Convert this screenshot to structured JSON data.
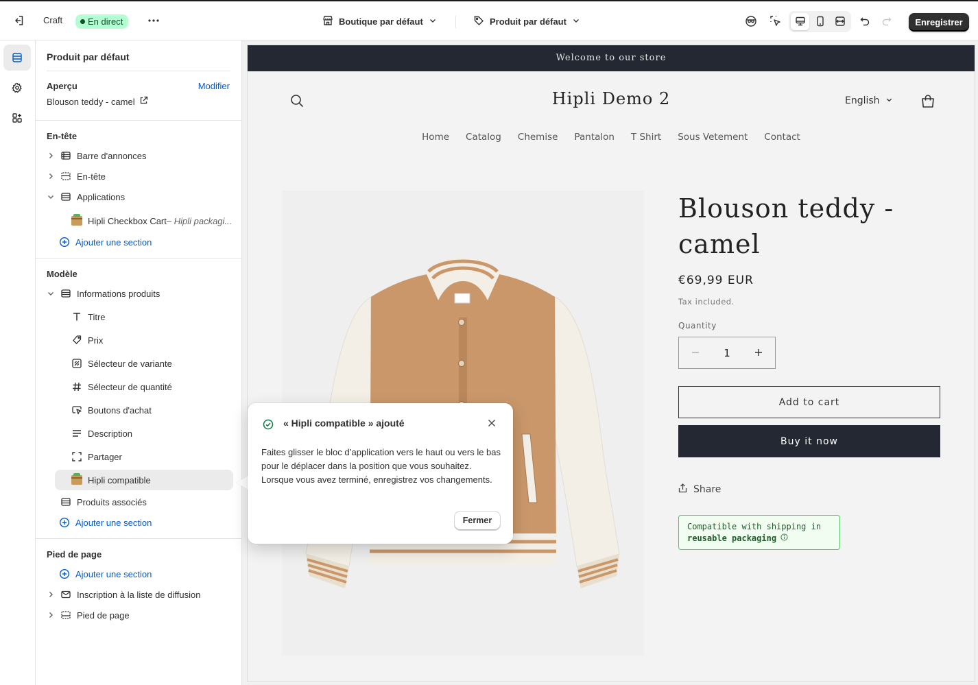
{
  "topbar": {
    "app_name": "Craft",
    "status": "En direct",
    "store_select": "Boutique par défaut",
    "product_select": "Produit par défaut",
    "save_label": "Enregistrer"
  },
  "sidebar": {
    "title": "Produit par défaut",
    "preview_heading": "Aperçu",
    "preview_edit": "Modifier",
    "preview_product": "Blouson teddy - camel",
    "header_group": {
      "title": "En-tête",
      "items": [
        "Barre d'annonces",
        "En-tête",
        "Applications"
      ],
      "app_block": "Hipli Checkbox Cart",
      "app_block_sub": " – Hipli packagi...",
      "add_section": "Ajouter une section"
    },
    "template_group": {
      "title": "Modèle",
      "section": "Informations produits",
      "blocks": [
        "Titre",
        "Prix",
        "Sélecteur de variante",
        "Sélecteur de quantité",
        "Boutons d'achat",
        "Description",
        "Partager",
        "Hipli compatible"
      ],
      "related": "Produits associés",
      "add_section": "Ajouter une section"
    },
    "footer_group": {
      "title": "Pied de page",
      "add_section": "Ajouter une section",
      "items": [
        "Inscription à la liste de diffusion",
        "Pied de page"
      ]
    }
  },
  "store": {
    "announcement": "Welcome to our store",
    "name": "Hipli Demo 2",
    "language": "English",
    "nav": [
      "Home",
      "Catalog",
      "Chemise",
      "Pantalon",
      "T Shirt",
      "Sous Vetement",
      "Contact"
    ],
    "product": {
      "title": "Blouson teddy - camel",
      "price": "€69,99 EUR",
      "tax": "Tax included.",
      "quantity_label": "Quantity",
      "quantity": "1",
      "add_to_cart": "Add to cart",
      "buy_now": "Buy it now",
      "share": "Share",
      "hipli_line1": "Compatible with shipping in",
      "hipli_line2": "reusable packaging"
    }
  },
  "popover": {
    "title": "« Hipli compatible » ajouté",
    "body": "Faites glisser le bloc d’application vers le haut ou vers le bas pour le déplacer dans la position que vous souhaitez. Lorsque vous avez terminé, enregistrez vos changements.",
    "close_label": "Fermer"
  },
  "colors": {
    "accent": "#005bd3",
    "live_badge_bg": "#b4fed2",
    "store_dark": "#242833",
    "jacket_camel": "#c9976a"
  }
}
